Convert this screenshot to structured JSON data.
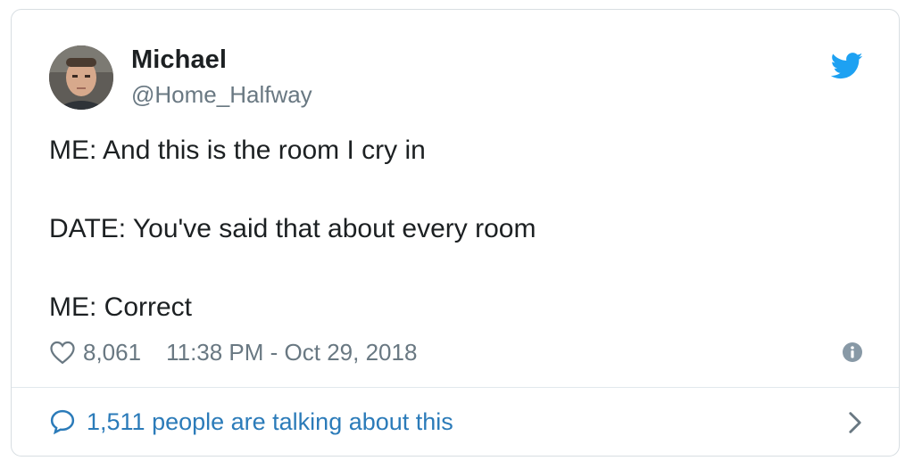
{
  "user": {
    "name": "Michael",
    "handle": "@Home_Halfway"
  },
  "tweet": {
    "lines": [
      "ME: And this is the room I cry in",
      "DATE: You've said that about every room",
      "ME: Correct"
    ]
  },
  "meta": {
    "likes": "8,061",
    "timestamp": "11:38 PM - Oct 29, 2018"
  },
  "footer": {
    "talking": "1,511 people are talking about this"
  },
  "icons": {
    "bird": "twitter-bird-icon",
    "heart": "heart-icon",
    "info": "info-icon",
    "bubble": "speech-bubble-icon",
    "chevron": "chevron-right-icon"
  },
  "colors": {
    "brand": "#1da1f2",
    "link": "#2b7bb9",
    "muted": "#697882",
    "text": "#1c2022"
  }
}
